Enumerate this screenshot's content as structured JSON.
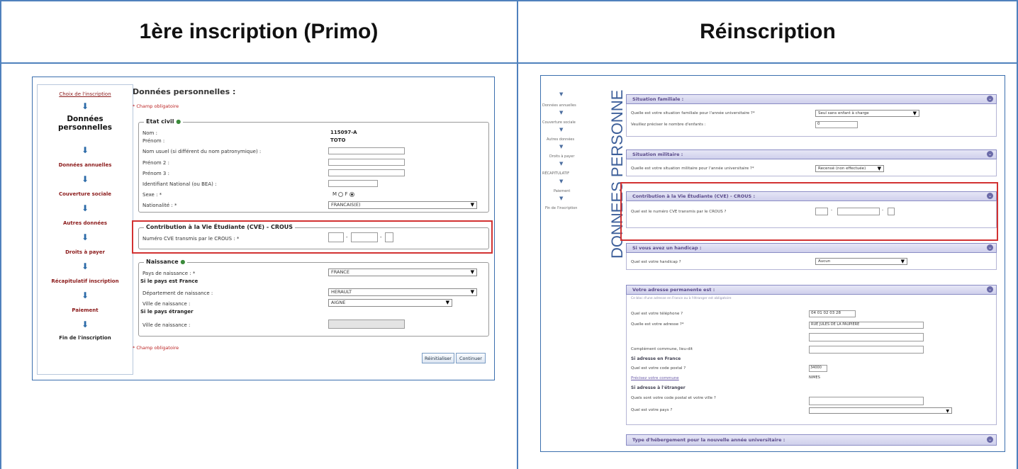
{
  "header": {
    "left_title": "1ère inscription (Primo)",
    "right_title": "Réinscription"
  },
  "primo": {
    "steps": [
      "Choix de l'inscription",
      "Données\npersonnelles",
      "Données annuelles",
      "Couverture sociale",
      "Autres données",
      "Droits à payer",
      "Récapitulatif inscription",
      "Paiement",
      "Fin de l'inscription"
    ],
    "heading": "Données personnelles :",
    "required_note": "* Champ obligatoire",
    "etat_civil": {
      "legend": "Etat civil",
      "nom_label": "Nom :",
      "nom_value": "115097-A",
      "prenom_label": "Prénom :",
      "prenom_value": "TOTO",
      "nom_usuel_label": "Nom usuel (si différent du nom patronymique) :",
      "prenom2_label": "Prénom 2 :",
      "prenom3_label": "Prénom 3 :",
      "ine_label": "Identifiant National (ou BEA) :",
      "sexe_label": "Sexe : *",
      "sexe_m": "M",
      "sexe_f": "F",
      "nationalite_label": "Nationalité : *",
      "nationalite_value": "FRANCAIS(E)"
    },
    "cve": {
      "legend": "Contribution à la Vie Étudiante (CVE) - CROUS",
      "label": "Numéro CVE transmis par le CROUS : *",
      "sep": "-"
    },
    "naissance": {
      "legend": "Naissance",
      "pays_label": "Pays de naissance : *",
      "pays_value": "FRANCE",
      "si_france": "Si le pays est France",
      "dept_label": "Département de naissance :",
      "dept_value": "HERAULT",
      "ville_label": "Ville de naissance :",
      "ville_value": "AIGNE",
      "si_etranger": "Si le pays étranger",
      "ville2_label": "Ville de naissance :"
    },
    "footer_note": "* Champ obligatoire",
    "btn_reset": "Réinitialiser",
    "btn_continue": "Continuer"
  },
  "reinscription": {
    "side_steps": [
      "Données annuelles",
      "Couverture sociale",
      "Autres données",
      "Droits à payer",
      "RÉCAPITULATIF",
      "Paiement",
      "Fin de l'inscription"
    ],
    "vertical_title": "DONNEES PERSONNE",
    "sections": {
      "familiale": {
        "title": "Situation familiale :",
        "q1": "Quelle est votre situation familiale pour l'année universitaire ?*",
        "q1_value": "Seul sans enfant à charge",
        "q2": "Veuillez préciser le nombre d'enfants :",
        "q2_value": "0"
      },
      "militaire": {
        "title": "Situation militaire :",
        "q1": "Quelle est votre situation militaire pour l'année universitaire ?*",
        "q1_value": "Recensé (non effectuée)"
      },
      "cve": {
        "title": "Contribution à la Vie Étudiante (CVE) - CROUS :",
        "q1": "Quel est le numéro CVE transmis par le CROUS ?",
        "sep": "-"
      },
      "handicap": {
        "title": "Si vous avez un handicap :",
        "q1": "Quel est votre handicap ?",
        "q1_value": "Aucun"
      },
      "adresse": {
        "title": "Votre adresse permanente est :",
        "sub": "Ce bloc d'une adresse en France ou à l'étranger est obligatoire",
        "tel_label": "Quel est votre téléphone ?",
        "tel_value": "04 01 02 03 28",
        "adr_label": "Quelle est votre adresse ?*",
        "adr_value": "RUE JULES DE LA PAUPIERE",
        "compl_label": "Complément commune, lieu-dit",
        "france_title": "Si adresse en France",
        "cp_label": "Quel est votre code postal ?",
        "cp_value": "34000",
        "commune_link": "Précisez votre commune",
        "commune_value": "NIMES",
        "etranger_title": "Si adresse à l'étranger",
        "cp_ville_label": "Quels sont votre code postal et votre ville ?",
        "pays_label": "Quel est votre pays ?"
      },
      "hebergement": {
        "title": "Type d'hébergement pour la nouvelle année universitaire :"
      }
    }
  }
}
